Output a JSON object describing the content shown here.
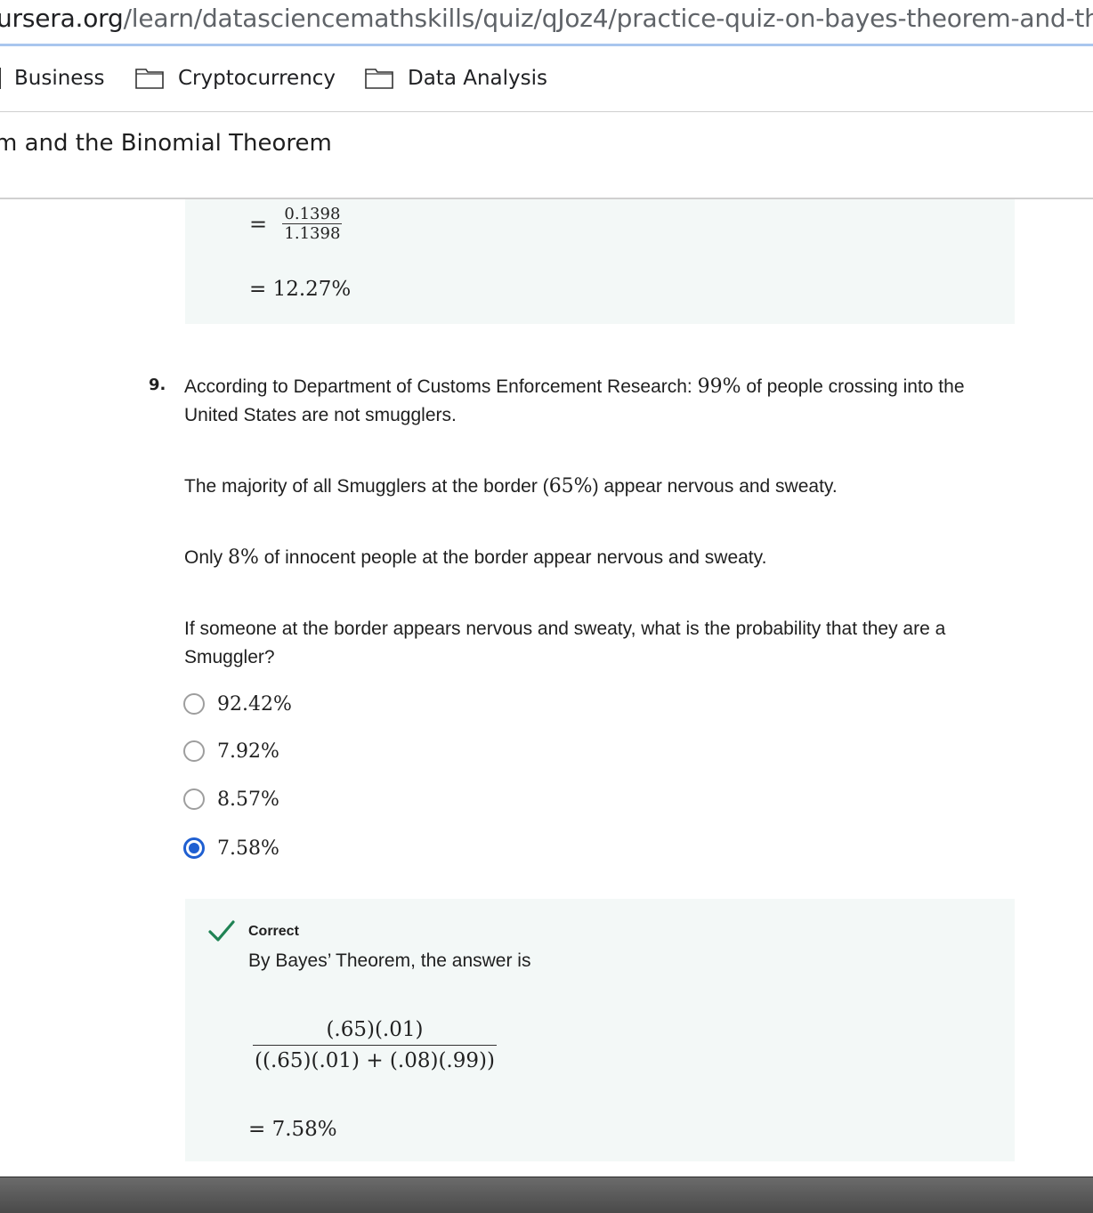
{
  "browser": {
    "url_host": "ursera.org",
    "url_path": "/learn/datasciencemathskills/quiz/qJoz4/practice-quiz-on-bayes-theorem-and-the",
    "bookmarks": [
      {
        "label": "Business",
        "icon": "folder-icon"
      },
      {
        "label": "Cryptocurrency",
        "icon": "folder-icon"
      },
      {
        "label": "Data Analysis",
        "icon": "folder-icon"
      }
    ]
  },
  "header": {
    "title": "m and the Binomial Theorem"
  },
  "prev_solution": {
    "frac_num": "0.1398",
    "frac_den": "1.1398",
    "result": "= 12.27%",
    "equals": "="
  },
  "question": {
    "number": "9.",
    "p1_a": "According to Department of Customs Enforcement Research: ",
    "p1_m": "99%",
    "p1_b": " of people crossing into the United States are not smugglers.",
    "p2_a": "The majority of all Smugglers at the border (",
    "p2_m": "65%",
    "p2_b": ") appear nervous and sweaty.",
    "p3_a": "Only ",
    "p3_m": "8%",
    "p3_b": " of innocent people at the border appear nervous and sweaty.",
    "p4": "If someone at the border appears nervous and sweaty, what is the probability that they are a Smuggler?",
    "options": [
      {
        "label": "92.42%",
        "selected": false
      },
      {
        "label": "7.92%",
        "selected": false
      },
      {
        "label": "8.57%",
        "selected": false
      },
      {
        "label": "7.58%",
        "selected": true
      }
    ]
  },
  "feedback": {
    "status": "Correct",
    "text": "By Bayes’ Theorem, the answer is",
    "frac_num": "(.65)(.01)",
    "frac_den": "((.65)(.01) + (.08)(.99))",
    "result": "= 7.58%",
    "check_color": "#1f8354"
  },
  "colors": {
    "accent": "#1f5fd1",
    "solution_bg": "#f3f8f7"
  }
}
